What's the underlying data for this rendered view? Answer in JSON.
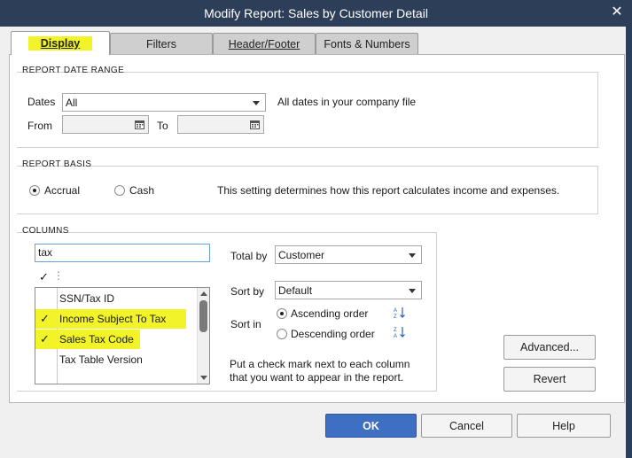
{
  "window": {
    "title": "Modify Report: Sales by Customer Detail"
  },
  "tabs": [
    {
      "label": "Display",
      "active": true
    },
    {
      "label": "Filters",
      "active": false
    },
    {
      "label": "Header/Footer",
      "active": false
    },
    {
      "label": "Fonts & Numbers",
      "active": false
    }
  ],
  "date_range": {
    "title": "REPORT DATE RANGE",
    "dates_label": "Dates",
    "dates_value": "All",
    "dates_hint": "All dates in your company file",
    "from_label": "From",
    "to_label": "To",
    "from_value": "",
    "to_value": ""
  },
  "basis": {
    "title": "REPORT BASIS",
    "accrual_label": "Accrual",
    "cash_label": "Cash",
    "selected": "Accrual",
    "note": "This setting determines how this report calculates income and expenses."
  },
  "columns": {
    "title": "COLUMNS",
    "search_value": "tax",
    "header_check": "✓",
    "header_more": "⋮",
    "items": [
      {
        "label": "SSN/Tax ID",
        "checked": false,
        "check": ""
      },
      {
        "label": "Income Subject To Tax",
        "checked": true,
        "check": "✓"
      },
      {
        "label": "Sales Tax Code",
        "checked": true,
        "check": "✓"
      },
      {
        "label": "Tax Table Version",
        "checked": false,
        "check": ""
      }
    ],
    "total_by_label": "Total by",
    "total_by_value": "Customer",
    "sort_by_label": "Sort by",
    "sort_by_value": "Default",
    "sort_in_label": "Sort in",
    "ascending_label": "Ascending order",
    "descending_label": "Descending order",
    "sort_selected": "Ascending order",
    "hint_line1": "Put a check mark next to each column",
    "hint_line2": "that you want to appear in the report."
  },
  "buttons": {
    "advanced": "Advanced...",
    "revert": "Revert",
    "ok": "OK",
    "cancel": "Cancel",
    "help": "Help"
  },
  "icons": {
    "close": "close-icon",
    "calendar": "calendar-icon",
    "sort_asc": "sort-ascending-icon",
    "sort_desc": "sort-descending-icon"
  },
  "colors": {
    "titlebar": "#2c3e58",
    "highlight": "#f3f32a",
    "primary_button": "#3f6fc2"
  }
}
